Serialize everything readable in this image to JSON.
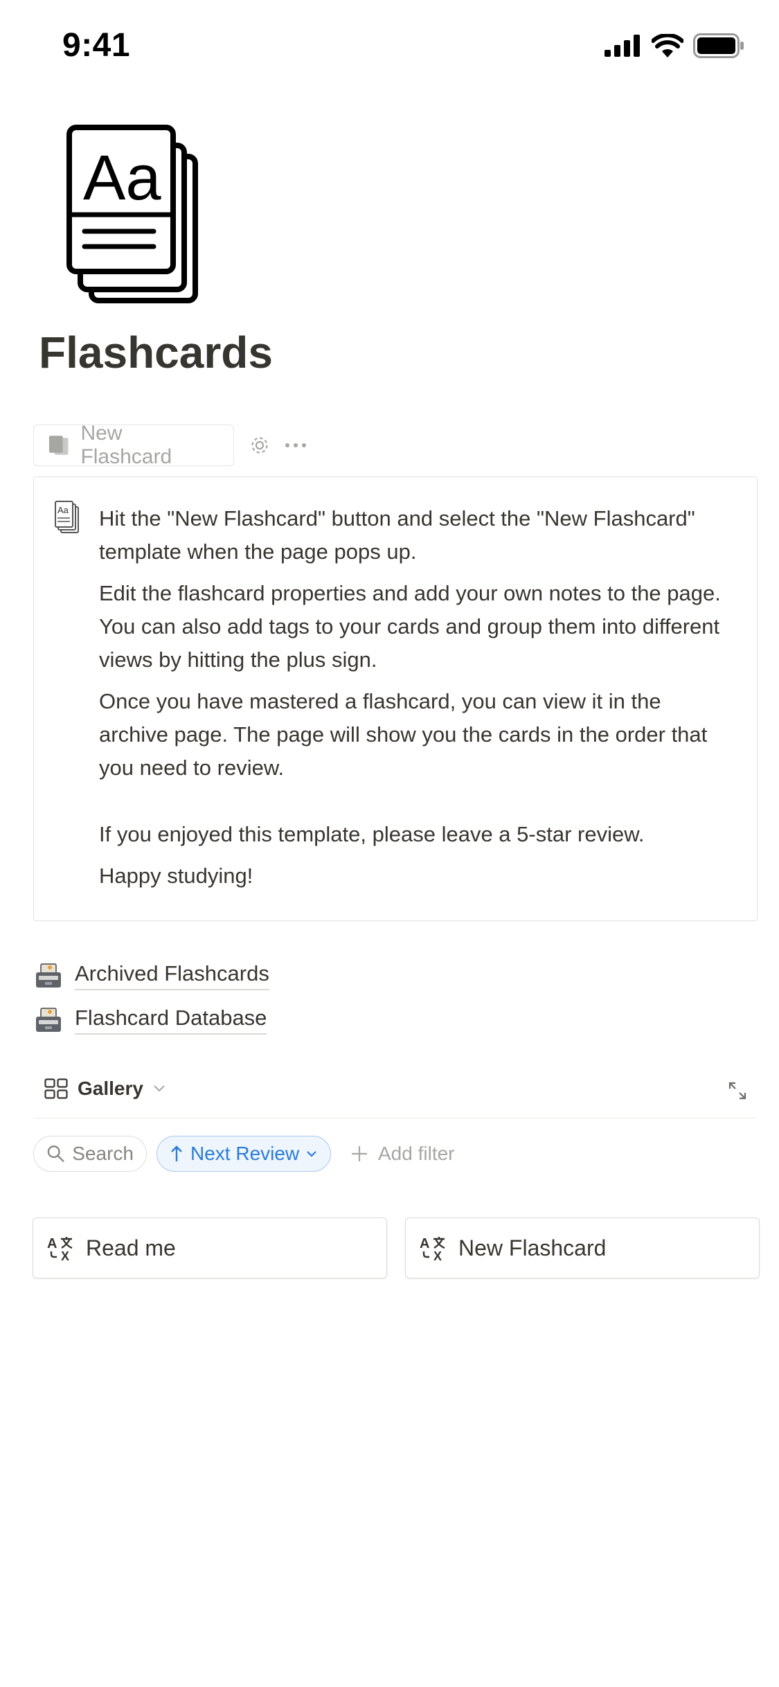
{
  "status_bar": {
    "time": "9:41"
  },
  "page": {
    "title": "Flashcards",
    "icon": "flashcard-book-icon"
  },
  "toolbar": {
    "new_button_label": "New Flashcard",
    "settings_icon": "gear-icon",
    "more_icon": "more-dots-icon"
  },
  "callout": {
    "icon": "flashcard-book-icon",
    "paragraphs": [
      "Hit the \"New Flashcard\" button and select the \"New Flashcard\" template when the page pops up.",
      "Edit the flashcard properties and add your own notes to the page. You can also add tags to your cards and group them into different views by hitting the plus sign.",
      "Once you have mastered a flashcard, you can view it in the archive page. The page will show you the cards in the order that you need to review.",
      "If you enjoyed this template, please leave a 5-star review.",
      "Happy studying!"
    ]
  },
  "links": [
    {
      "label": "Archived Flashcards",
      "icon": "file-box-icon"
    },
    {
      "label": "Flashcard Database",
      "icon": "file-box-icon"
    }
  ],
  "gallery": {
    "view_label": "Gallery",
    "search_label": "Search",
    "sort_label": "Next Review",
    "add_filter_label": "Add filter",
    "cards": [
      {
        "title": "Read me",
        "icon": "translate-icon"
      },
      {
        "title": "New Flashcard",
        "icon": "translate-icon"
      }
    ]
  },
  "colors": {
    "text": "#37352f",
    "muted": "#a6a6a3",
    "accent_blue": "#2b7bd9"
  }
}
